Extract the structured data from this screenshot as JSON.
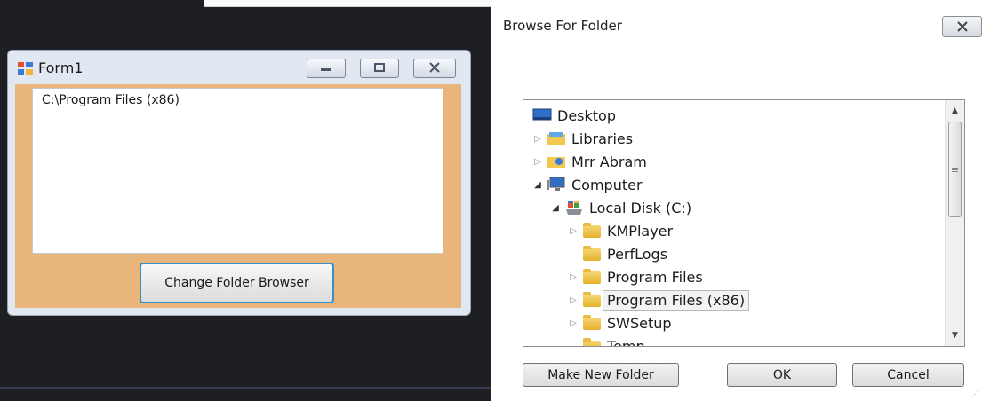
{
  "form1": {
    "title": "Form1",
    "textbox_value": "C:\\Program Files (x86)",
    "change_button_label": "Change Folder Browser",
    "colors": {
      "client_bg": "#e8b67a",
      "button_focus_border": "#3c8ec8"
    }
  },
  "dialog": {
    "title": "Browse For Folder",
    "tree": [
      {
        "label": "Desktop",
        "icon": "desktop-icon",
        "expander": ""
      },
      {
        "label": "Libraries",
        "icon": "libraries-icon",
        "expander": "▷"
      },
      {
        "label": "Mrr Abram",
        "icon": "user-folder-icon",
        "expander": "▷"
      },
      {
        "label": "Computer",
        "icon": "computer-icon",
        "expander": "◢"
      },
      {
        "label": "Local Disk (C:)",
        "icon": "disk-icon",
        "expander": "◢"
      },
      {
        "label": "KMPlayer",
        "icon": "folder-icon",
        "expander": "▷"
      },
      {
        "label": "PerfLogs",
        "icon": "folder-icon",
        "expander": ""
      },
      {
        "label": "Program Files",
        "icon": "folder-icon",
        "expander": "▷"
      },
      {
        "label": "Program Files (x86)",
        "icon": "folder-icon",
        "expander": "▷",
        "selected": true
      },
      {
        "label": "SWSetup",
        "icon": "folder-icon",
        "expander": "▷"
      },
      {
        "label": "Temp",
        "icon": "folder-icon",
        "expander": ""
      }
    ],
    "buttons": {
      "make_new_folder": "Make New Folder",
      "ok": "OK",
      "cancel": "Cancel"
    }
  }
}
